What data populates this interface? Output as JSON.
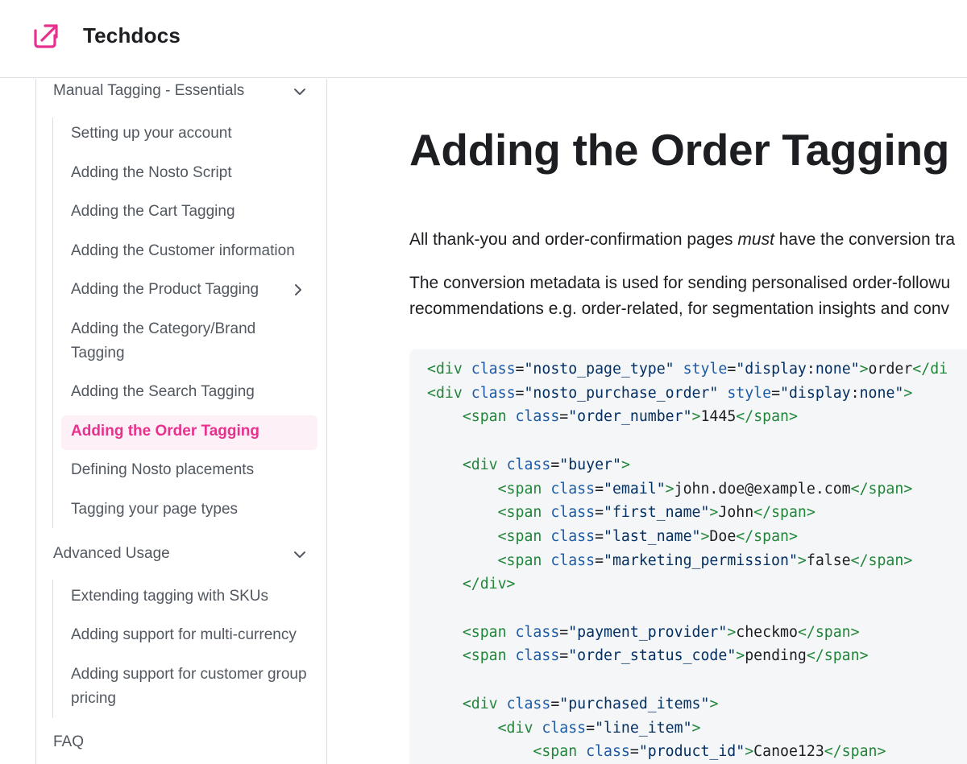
{
  "header": {
    "brand": "Techdocs"
  },
  "sidebar": {
    "categories": [
      {
        "label": "Manual Tagging - Essentials",
        "expanded": true,
        "items": [
          {
            "label": "Setting up your account"
          },
          {
            "label": "Adding the Nosto Script"
          },
          {
            "label": "Adding the Cart Tagging"
          },
          {
            "label": "Adding the Customer information"
          },
          {
            "label": "Adding the Product Tagging",
            "has_children": true
          },
          {
            "label_line1": "Adding the Category/Brand",
            "label_line2": "Tagging"
          },
          {
            "label": "Adding the Search Tagging"
          },
          {
            "label": "Adding the Order Tagging",
            "active": true
          },
          {
            "label": "Defining Nosto placements"
          },
          {
            "label": "Tagging your page types"
          }
        ]
      },
      {
        "label": "Advanced Usage",
        "expanded": true,
        "items": [
          {
            "label": "Extending tagging with SKUs"
          },
          {
            "label": "Adding support for multi-currency"
          },
          {
            "label_line1": "Adding support for customer group",
            "label_line2": "pricing"
          }
        ]
      },
      {
        "label": "FAQ"
      }
    ]
  },
  "main": {
    "title": "Adding the Order Tagging",
    "para1_before": "All thank-you and order-confirmation pages ",
    "para1_em": "must",
    "para1_after": " have the conversion tra",
    "para2_line1": "The conversion metadata is used for sending personalised order-followu",
    "para2_line2": "recommendations e.g. order-related, for segmentation insights and conv",
    "code_lines": [
      [
        [
          "tag",
          "<div"
        ],
        [
          "txt",
          " "
        ],
        [
          "attr",
          "class"
        ],
        [
          "punc",
          "="
        ],
        [
          "str",
          "\"nosto_page_type\""
        ],
        [
          "txt",
          " "
        ],
        [
          "attr",
          "style"
        ],
        [
          "punc",
          "="
        ],
        [
          "str",
          "\"display"
        ],
        [
          "punc",
          ":"
        ],
        [
          "str",
          "none\""
        ],
        [
          "tag",
          ">"
        ],
        [
          "txt",
          "order"
        ],
        [
          "tag",
          "</di"
        ]
      ],
      [
        [
          "tag",
          "<div"
        ],
        [
          "txt",
          " "
        ],
        [
          "attr",
          "class"
        ],
        [
          "punc",
          "="
        ],
        [
          "str",
          "\"nosto_purchase_order\""
        ],
        [
          "txt",
          " "
        ],
        [
          "attr",
          "style"
        ],
        [
          "punc",
          "="
        ],
        [
          "str",
          "\"display"
        ],
        [
          "punc",
          ":"
        ],
        [
          "str",
          "none\""
        ],
        [
          "tag",
          ">"
        ]
      ],
      [
        [
          "txt",
          "    "
        ],
        [
          "tag",
          "<span"
        ],
        [
          "txt",
          " "
        ],
        [
          "attr",
          "class"
        ],
        [
          "punc",
          "="
        ],
        [
          "str",
          "\"order_number\""
        ],
        [
          "tag",
          ">"
        ],
        [
          "txt",
          "1445"
        ],
        [
          "tag",
          "</span>"
        ]
      ],
      [],
      [
        [
          "txt",
          "    "
        ],
        [
          "tag",
          "<div"
        ],
        [
          "txt",
          " "
        ],
        [
          "attr",
          "class"
        ],
        [
          "punc",
          "="
        ],
        [
          "str",
          "\"buyer\""
        ],
        [
          "tag",
          ">"
        ]
      ],
      [
        [
          "txt",
          "        "
        ],
        [
          "tag",
          "<span"
        ],
        [
          "txt",
          " "
        ],
        [
          "attr",
          "class"
        ],
        [
          "punc",
          "="
        ],
        [
          "str",
          "\"email\""
        ],
        [
          "tag",
          ">"
        ],
        [
          "txt",
          "john.doe@example.com"
        ],
        [
          "tag",
          "</span>"
        ]
      ],
      [
        [
          "txt",
          "        "
        ],
        [
          "tag",
          "<span"
        ],
        [
          "txt",
          " "
        ],
        [
          "attr",
          "class"
        ],
        [
          "punc",
          "="
        ],
        [
          "str",
          "\"first_name\""
        ],
        [
          "tag",
          ">"
        ],
        [
          "txt",
          "John"
        ],
        [
          "tag",
          "</span>"
        ]
      ],
      [
        [
          "txt",
          "        "
        ],
        [
          "tag",
          "<span"
        ],
        [
          "txt",
          " "
        ],
        [
          "attr",
          "class"
        ],
        [
          "punc",
          "="
        ],
        [
          "str",
          "\"last_name\""
        ],
        [
          "tag",
          ">"
        ],
        [
          "txt",
          "Doe"
        ],
        [
          "tag",
          "</span>"
        ]
      ],
      [
        [
          "txt",
          "        "
        ],
        [
          "tag",
          "<span"
        ],
        [
          "txt",
          " "
        ],
        [
          "attr",
          "class"
        ],
        [
          "punc",
          "="
        ],
        [
          "str",
          "\"marketing_permission\""
        ],
        [
          "tag",
          ">"
        ],
        [
          "txt",
          "false"
        ],
        [
          "tag",
          "</span>"
        ]
      ],
      [
        [
          "txt",
          "    "
        ],
        [
          "tag",
          "</div>"
        ]
      ],
      [],
      [
        [
          "txt",
          "    "
        ],
        [
          "tag",
          "<span"
        ],
        [
          "txt",
          " "
        ],
        [
          "attr",
          "class"
        ],
        [
          "punc",
          "="
        ],
        [
          "str",
          "\"payment_provider\""
        ],
        [
          "tag",
          ">"
        ],
        [
          "txt",
          "checkmo"
        ],
        [
          "tag",
          "</span>"
        ]
      ],
      [
        [
          "txt",
          "    "
        ],
        [
          "tag",
          "<span"
        ],
        [
          "txt",
          " "
        ],
        [
          "attr",
          "class"
        ],
        [
          "punc",
          "="
        ],
        [
          "str",
          "\"order_status_code\""
        ],
        [
          "tag",
          ">"
        ],
        [
          "txt",
          "pending"
        ],
        [
          "tag",
          "</span>"
        ]
      ],
      [],
      [
        [
          "txt",
          "    "
        ],
        [
          "tag",
          "<div"
        ],
        [
          "txt",
          " "
        ],
        [
          "attr",
          "class"
        ],
        [
          "punc",
          "="
        ],
        [
          "str",
          "\"purchased_items\""
        ],
        [
          "tag",
          ">"
        ]
      ],
      [
        [
          "txt",
          "        "
        ],
        [
          "tag",
          "<div"
        ],
        [
          "txt",
          " "
        ],
        [
          "attr",
          "class"
        ],
        [
          "punc",
          "="
        ],
        [
          "str",
          "\"line_item\""
        ],
        [
          "tag",
          ">"
        ]
      ],
      [
        [
          "txt",
          "            "
        ],
        [
          "tag",
          "<span"
        ],
        [
          "txt",
          " "
        ],
        [
          "attr",
          "class"
        ],
        [
          "punc",
          "="
        ],
        [
          "str",
          "\"product_id\""
        ],
        [
          "tag",
          ">"
        ],
        [
          "txt",
          "Canoe123"
        ],
        [
          "tag",
          "</span>"
        ]
      ]
    ]
  },
  "colors": {
    "accent": "#e8318f",
    "active_bg": "#fdf0f6",
    "code_bg": "#f5f6f7",
    "code_tag": "#22863a",
    "code_attr": "#1c5aa6",
    "code_string": "#032f62"
  },
  "icons": {
    "logo": "arrow-up-right-box-icon",
    "expand": "chevron-down-icon",
    "collapsed": "chevron-right-icon"
  }
}
